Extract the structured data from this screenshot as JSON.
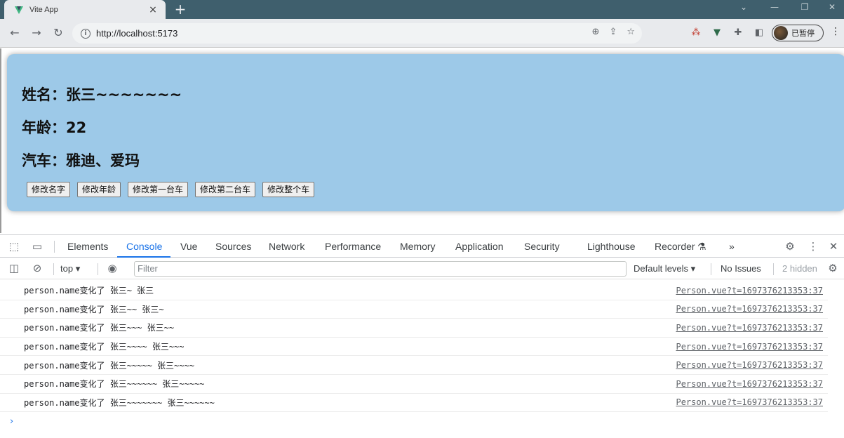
{
  "browser": {
    "tab_title": "Vite App",
    "tab_close": "×",
    "new_tab": "+",
    "url": "http://localhost:5173",
    "profile_label": "已暂停"
  },
  "page": {
    "name_label": "姓名：",
    "name_value": "张三~~~~~~~",
    "age_label": "年龄：",
    "age_value": "22",
    "cars_label": "汽车：",
    "cars_value": "雅迪、爱玛",
    "buttons": [
      "修改名字",
      "修改年龄",
      "修改第一台车",
      "修改第二台车",
      "修改整个车"
    ]
  },
  "devtools": {
    "tabs": [
      "Elements",
      "Console",
      "Vue",
      "Sources",
      "Network",
      "Performance",
      "Memory",
      "Application",
      "Security",
      "Lighthouse",
      "Recorder"
    ],
    "active_tab": "Console",
    "more": "»",
    "context": "top",
    "filter_placeholder": "Filter",
    "levels": "Default levels",
    "issues": "No Issues",
    "hidden": "2 hidden",
    "logs": [
      {
        "msg": "person.name变化了 张三~ 张三",
        "src": "Person.vue?t=1697376213353:37"
      },
      {
        "msg": "person.name变化了 张三~~ 张三~",
        "src": "Person.vue?t=1697376213353:37"
      },
      {
        "msg": "person.name变化了 张三~~~ 张三~~",
        "src": "Person.vue?t=1697376213353:37"
      },
      {
        "msg": "person.name变化了 张三~~~~ 张三~~~",
        "src": "Person.vue?t=1697376213353:37"
      },
      {
        "msg": "person.name变化了 张三~~~~~ 张三~~~~",
        "src": "Person.vue?t=1697376213353:37"
      },
      {
        "msg": "person.name变化了 张三~~~~~~ 张三~~~~~",
        "src": "Person.vue?t=1697376213353:37"
      },
      {
        "msg": "person.name变化了 张三~~~~~~~ 张三~~~~~~",
        "src": "Person.vue?t=1697376213353:37"
      }
    ],
    "prompt": "›"
  }
}
